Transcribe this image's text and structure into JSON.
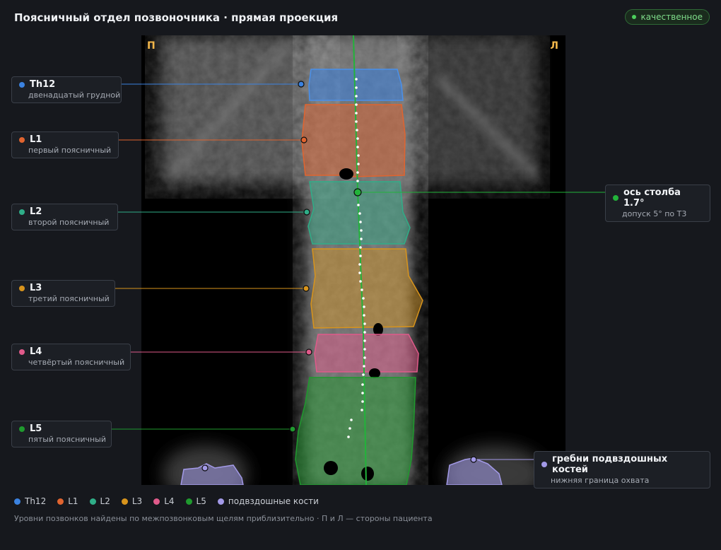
{
  "header": {
    "title": "Поясничный отдел позвоночника · прямая проекция",
    "badge": "качественное"
  },
  "image": {
    "side_right": "П",
    "side_left": "Л"
  },
  "callouts": [
    {
      "name": "Th12",
      "sub": "двенадцатый грудной",
      "color": "#3b82e0"
    },
    {
      "name": "L1",
      "sub": "первый поясничный",
      "color": "#e0642f"
    },
    {
      "name": "L2",
      "sub": "второй поясничный",
      "color": "#2fae88"
    },
    {
      "name": "L3",
      "sub": "третий поясничный",
      "color": "#d8941c"
    },
    {
      "name": "L4",
      "sub": "четвёртый поясничный",
      "color": "#e05a8a"
    },
    {
      "name": "L5",
      "sub": "пятый поясничный",
      "color": "#1f9a2e"
    }
  ],
  "axis": {
    "name": "ось столба 1.7°",
    "sub": "допуск 5° по Т3",
    "color": "#22b33a"
  },
  "iliac": {
    "name": "гребни подвздошных костей",
    "sub": "нижняя граница охвата",
    "color": "#a39ae8"
  },
  "legend": [
    {
      "label": "Th12",
      "color": "#3b82e0"
    },
    {
      "label": "L1",
      "color": "#e0642f"
    },
    {
      "label": "L2",
      "color": "#2fae88"
    },
    {
      "label": "L3",
      "color": "#d8941c"
    },
    {
      "label": "L4",
      "color": "#e05a8a"
    },
    {
      "label": "L5",
      "color": "#1f9a2e"
    },
    {
      "label": "подвздошные кости",
      "color": "#a39ae8"
    }
  ],
  "footnote": "Уровни позвонков найдены по межпозвонковым щелям приблизительно · П и Л — стороны пациента"
}
